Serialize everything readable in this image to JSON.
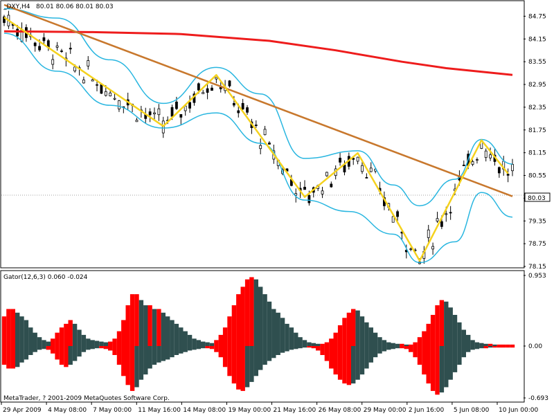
{
  "header": {
    "symbol_label": "_DXY,H4",
    "ohlc_label": "80.01 80.06 80.01 80.03"
  },
  "footer": {
    "copyright": "MetaTrader, ? 2001-2009 MetaQuotes Software Corp."
  },
  "colors": {
    "background": "#ffffff",
    "candle": "#000000",
    "zigzag": "#f5d21e",
    "trendline": "#c8782d",
    "ma": "#ee1c1c",
    "envelope": "#29b6e0",
    "gator_up": "#ff0000",
    "gator_down": "#2f4f4f",
    "grid": "#c0c0c0"
  },
  "chart_data": [
    {
      "type": "candlestick",
      "symbol": "_DXY",
      "timeframe": "H4",
      "current_price": "80.03",
      "ylim": [
        78.15,
        85.05
      ],
      "ytick_labels": [
        "84.75",
        "84.15",
        "83.55",
        "82.95",
        "82.35",
        "81.75",
        "81.15",
        "80.55",
        "79.95",
        "79.35",
        "78.75",
        "78.15"
      ],
      "xtick_labels": [
        "29 Apr 2009",
        "4 May 08:00",
        "7 May 00:00",
        "11 May 16:00",
        "14 May 08:00",
        "19 May 00:00",
        "21 May 16:00",
        "26 May 08:00",
        "29 May 00:00",
        "2 Jun 16:00",
        "5 Jun 08:00",
        "10 Jun 00:00"
      ],
      "zigzag_points": [
        [
          0,
          84.72
        ],
        [
          36,
          81.85
        ],
        [
          48,
          83.2
        ],
        [
          68,
          79.98
        ],
        [
          80,
          81.14
        ],
        [
          94,
          78.3
        ],
        [
          108,
          81.48
        ],
        [
          114,
          80.6
        ]
      ],
      "trendline": [
        [
          0,
          85.05
        ],
        [
          115,
          80.0
        ]
      ],
      "moving_average": [
        [
          0,
          84.35
        ],
        [
          20,
          84.33
        ],
        [
          40,
          84.28
        ],
        [
          60,
          84.1
        ],
        [
          75,
          83.85
        ],
        [
          90,
          83.55
        ],
        [
          100,
          83.38
        ],
        [
          115,
          83.2
        ]
      ],
      "envelope_upper": [
        [
          0,
          84.95
        ],
        [
          12,
          84.7
        ],
        [
          24,
          83.6
        ],
        [
          36,
          82.45
        ],
        [
          48,
          83.4
        ],
        [
          58,
          82.7
        ],
        [
          68,
          81.0
        ],
        [
          80,
          81.2
        ],
        [
          88,
          80.3
        ],
        [
          94,
          79.75
        ],
        [
          102,
          80.45
        ],
        [
          108,
          81.5
        ],
        [
          115,
          80.85
        ]
      ],
      "envelope_lower": [
        [
          0,
          84.3
        ],
        [
          12,
          83.3
        ],
        [
          24,
          82.4
        ],
        [
          36,
          81.8
        ],
        [
          48,
          82.2
        ],
        [
          58,
          81.4
        ],
        [
          68,
          79.9
        ],
        [
          78,
          79.6
        ],
        [
          88,
          79.0
        ],
        [
          94,
          78.25
        ],
        [
          102,
          78.8
        ],
        [
          108,
          80.1
        ],
        [
          115,
          79.45
        ]
      ]
    },
    {
      "type": "bar",
      "indicator_label": "Gator(12,6,3) 0.060 -0.024",
      "ytick_labels": [
        "0.953",
        "0.00",
        "-0.693"
      ],
      "ylim": [
        -0.693,
        0.953
      ],
      "upper_histogram": [
        0.4,
        0.5,
        0.5,
        0.45,
        0.4,
        0.35,
        0.25,
        0.18,
        0.12,
        0.08,
        0.06,
        0.1,
        0.18,
        0.25,
        0.3,
        0.35,
        0.3,
        0.22,
        0.15,
        0.1,
        0.08,
        0.07,
        0.06,
        0.05,
        0.06,
        0.1,
        0.2,
        0.35,
        0.55,
        0.7,
        0.7,
        0.62,
        0.55,
        0.55,
        0.5,
        0.5,
        0.45,
        0.4,
        0.35,
        0.3,
        0.25,
        0.2,
        0.15,
        0.1,
        0.08,
        0.06,
        0.05,
        0.04,
        0.08,
        0.15,
        0.25,
        0.4,
        0.55,
        0.7,
        0.8,
        0.9,
        0.93,
        0.9,
        0.8,
        0.7,
        0.6,
        0.5,
        0.45,
        0.38,
        0.3,
        0.25,
        0.18,
        0.12,
        0.08,
        0.05,
        0.04,
        0.03,
        0.03,
        0.05,
        0.1,
        0.18,
        0.28,
        0.38,
        0.45,
        0.5,
        0.48,
        0.4,
        0.32,
        0.25,
        0.18,
        0.12,
        0.08,
        0.05,
        0.04,
        0.03,
        0.03,
        0.02,
        0.02,
        0.05,
        0.12,
        0.2,
        0.3,
        0.42,
        0.55,
        0.62,
        0.6,
        0.52,
        0.42,
        0.32,
        0.22,
        0.15,
        0.08,
        0.05,
        0.04,
        0.03,
        0.03,
        0.02,
        0.02,
        0.02,
        0.02,
        0.02
      ],
      "lower_histogram": [
        -0.25,
        -0.3,
        -0.3,
        -0.28,
        -0.22,
        -0.18,
        -0.12,
        -0.08,
        -0.05,
        -0.04,
        -0.05,
        -0.1,
        -0.18,
        -0.25,
        -0.28,
        -0.25,
        -0.2,
        -0.14,
        -0.08,
        -0.05,
        -0.04,
        -0.03,
        -0.03,
        -0.04,
        -0.06,
        -0.12,
        -0.25,
        -0.4,
        -0.52,
        -0.6,
        -0.55,
        -0.45,
        -0.38,
        -0.3,
        -0.25,
        -0.22,
        -0.2,
        -0.18,
        -0.15,
        -0.12,
        -0.1,
        -0.08,
        -0.06,
        -0.05,
        -0.04,
        -0.03,
        -0.03,
        -0.04,
        -0.08,
        -0.15,
        -0.28,
        -0.4,
        -0.5,
        -0.58,
        -0.6,
        -0.55,
        -0.48,
        -0.4,
        -0.32,
        -0.25,
        -0.2,
        -0.16,
        -0.12,
        -0.09,
        -0.07,
        -0.05,
        -0.04,
        -0.03,
        -0.02,
        -0.02,
        -0.03,
        -0.06,
        -0.12,
        -0.2,
        -0.3,
        -0.38,
        -0.45,
        -0.5,
        -0.52,
        -0.5,
        -0.45,
        -0.38,
        -0.3,
        -0.22,
        -0.15,
        -0.1,
        -0.07,
        -0.05,
        -0.04,
        -0.03,
        -0.03,
        -0.04,
        -0.08,
        -0.15,
        -0.25,
        -0.38,
        -0.5,
        -0.6,
        -0.65,
        -0.62,
        -0.55,
        -0.45,
        -0.35,
        -0.25,
        -0.15,
        -0.08,
        -0.05,
        -0.04,
        -0.03,
        -0.03,
        -0.02,
        -0.02,
        -0.02,
        -0.02,
        -0.02,
        -0.02
      ]
    }
  ]
}
